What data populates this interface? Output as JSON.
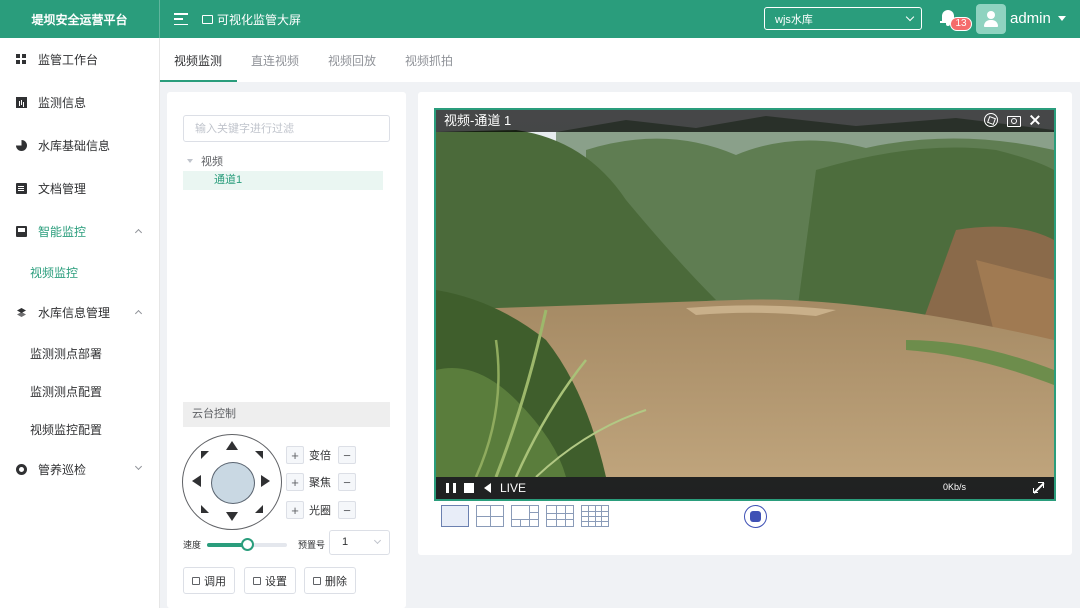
{
  "header": {
    "logo_text": "堤坝安全运营平台",
    "screen_link": "可视化监管大屏",
    "reservoir_select": "wjs水库",
    "notification_count": "13",
    "username": "admin"
  },
  "sidebar": {
    "items": [
      {
        "label": "监管工作台",
        "icon": "grid-icon"
      },
      {
        "label": "监测信息",
        "icon": "bar-chart-icon"
      },
      {
        "label": "水库基础信息",
        "icon": "pie-chart-icon"
      },
      {
        "label": "文档管理",
        "icon": "document-icon"
      },
      {
        "label": "智能监控",
        "icon": "monitor-icon",
        "expanded": true,
        "active": true,
        "children": [
          {
            "label": "视频监控",
            "active": true
          }
        ]
      },
      {
        "label": "水库信息管理",
        "icon": "layers-icon",
        "expanded": true,
        "children": [
          {
            "label": "监测测点部署"
          },
          {
            "label": "监测测点配置"
          },
          {
            "label": "视频监控配置"
          }
        ]
      },
      {
        "label": "管养巡检",
        "icon": "gear-icon",
        "expanded": false
      }
    ]
  },
  "tabs": [
    {
      "label": "视频监测",
      "active": true
    },
    {
      "label": "直连视频"
    },
    {
      "label": "视频回放"
    },
    {
      "label": "视频抓拍"
    }
  ],
  "tree": {
    "filter_placeholder": "输入关键字进行过滤",
    "root": "视频",
    "child": "通道1"
  },
  "ptz": {
    "header": "云台控制",
    "zoom_label": "变倍",
    "focus_label": "聚焦",
    "iris_label": "光圈",
    "plus": "+",
    "minus": "−",
    "speed_label": "速度",
    "speed_value": 0.5,
    "preset_label": "预置号",
    "preset_value": "1",
    "call_button": "调用",
    "set_button": "设置",
    "delete_button": "删除"
  },
  "player": {
    "title": "视频-通道 1",
    "live_label": "LIVE",
    "bitrate": "0Kb/s"
  },
  "colors": {
    "brand": "#2a9d7c",
    "badge": "#f56c6c",
    "record": "#3f51b5"
  }
}
